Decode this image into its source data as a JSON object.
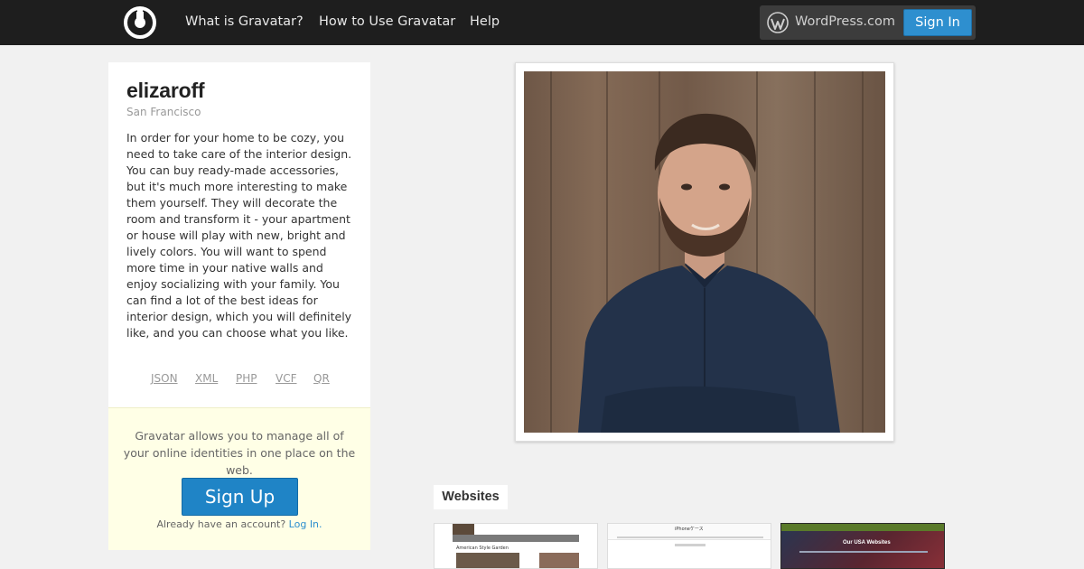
{
  "header": {
    "logo": "gravatar-logo-icon",
    "nav": [
      {
        "label": "What is Gravatar?"
      },
      {
        "label": "How to Use Gravatar"
      },
      {
        "label": "Help"
      }
    ],
    "wordpress_label": "WordPress.com",
    "signin_label": "Sign In"
  },
  "profile": {
    "username": "elizaroff",
    "location": "San Francisco",
    "bio": "In order for your home to be cozy, you need to take care of the interior design. You can buy ready-made accessories, but it's much more interesting to make them yourself. They will decorate the room and transform it - your apartment or house will play with new, bright and lively colors. You will want to spend more time in your native walls and enjoy socializing with your family. You can find a lot of the best ideas for interior design, which you will definitely like, and you can choose what you like.",
    "formats": [
      "JSON",
      "XML",
      "PHP",
      "VCF",
      "QR"
    ]
  },
  "promo": {
    "text": "Gravatar allows you to manage all of your online identities in one place on the web.",
    "signup_label": "Sign Up",
    "login_prompt": "Already have an account?",
    "login_link": "Log In."
  },
  "websites": {
    "label": "Websites",
    "thumbnails": [
      {
        "title": "American Style Garden"
      },
      {
        "title": "iPhoneケース"
      },
      {
        "title": "Our USA Websites"
      }
    ]
  },
  "colors": {
    "topbar": "#1e1e1e",
    "accent": "#2e8fcf",
    "promo_bg": "#ffffe6",
    "page_bg": "#f1f1f1"
  }
}
